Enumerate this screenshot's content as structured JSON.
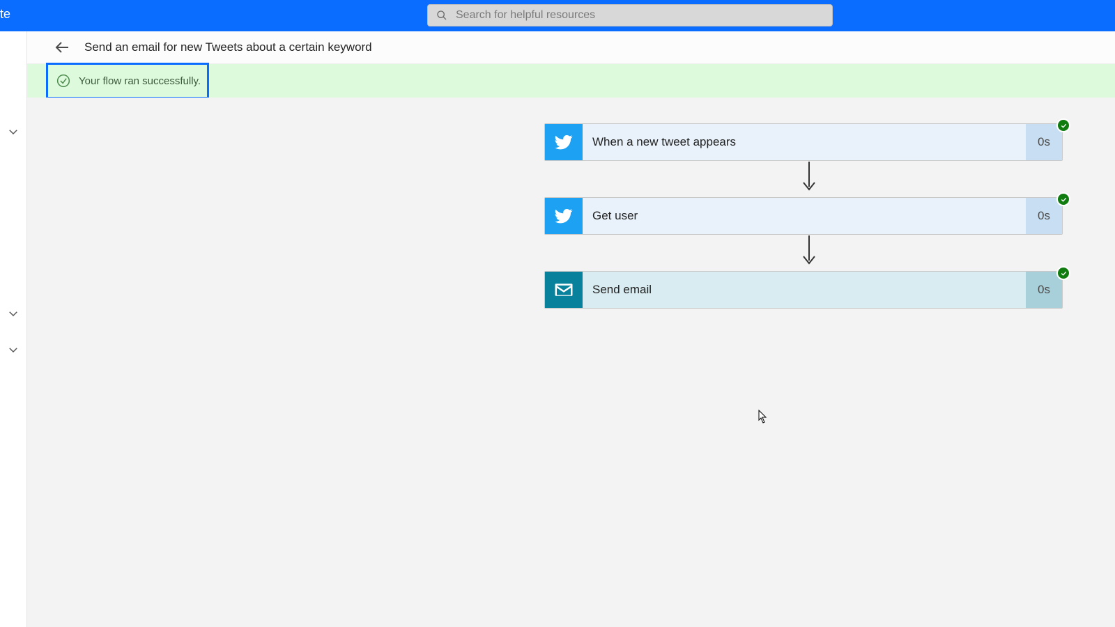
{
  "appbar": {
    "brand_fragment": "te"
  },
  "search": {
    "placeholder": "Search for helpful resources"
  },
  "breadcrumb": {
    "title": "Send an email for new Tweets about a certain keyword"
  },
  "banner": {
    "message": "Your flow ran successfully."
  },
  "flow": {
    "steps": [
      {
        "id": "trigger",
        "label": "When a new tweet appears",
        "duration": "0s",
        "icon": "twitter",
        "status": "success"
      },
      {
        "id": "get-user",
        "label": "Get user",
        "duration": "0s",
        "icon": "twitter",
        "status": "success"
      },
      {
        "id": "send",
        "label": "Send email",
        "duration": "0s",
        "icon": "email",
        "status": "success"
      }
    ]
  },
  "colors": {
    "accent": "#0a6dff",
    "twitter": "#1da1f2",
    "email": "#07819c",
    "success": "#107c10",
    "banner_bg": "#defadd"
  }
}
